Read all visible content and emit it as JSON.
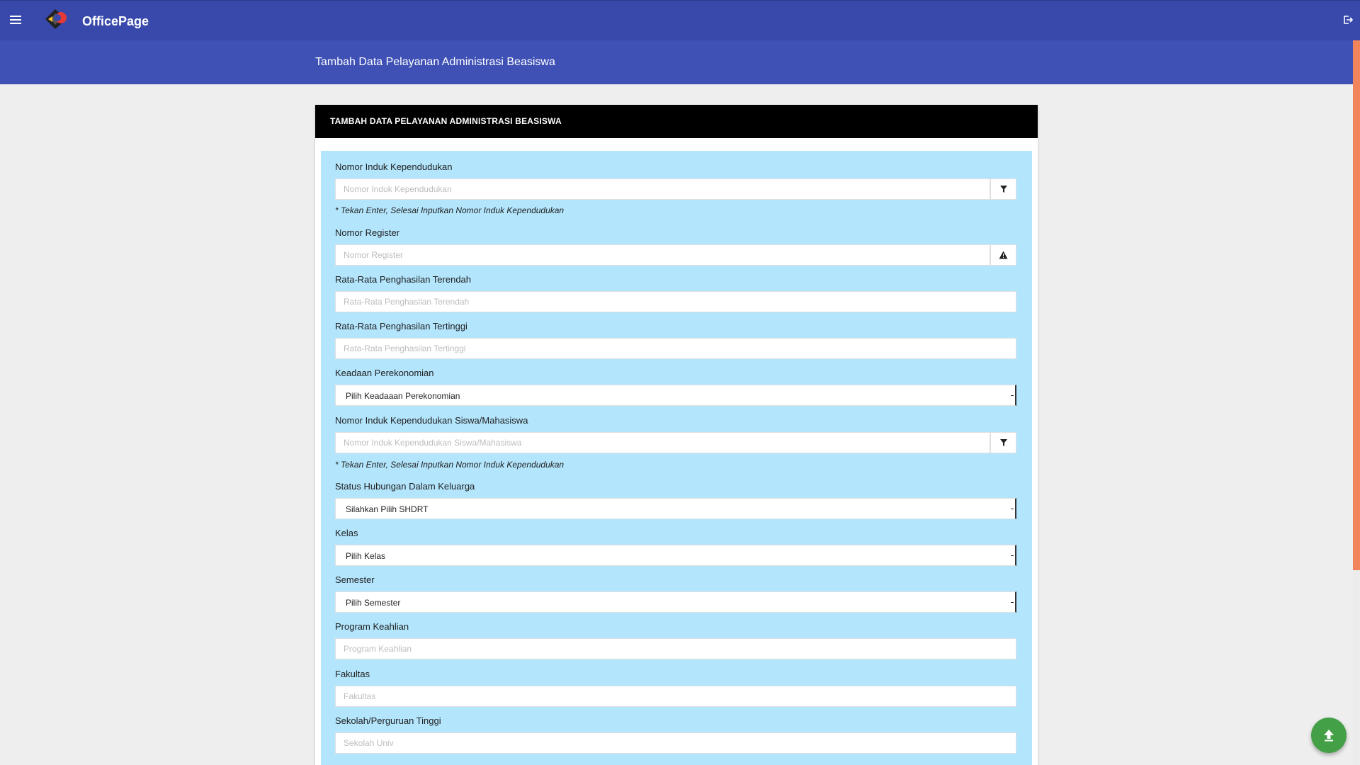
{
  "app": {
    "brand": "OfficePage"
  },
  "header": {
    "page_title": "Tambah Data Pelayanan Administrasi Beasiswa"
  },
  "card": {
    "title": "TAMBAH DATA PELAYANAN ADMINISTRASI BEASISWA"
  },
  "icons": {
    "menu": "hamburger-menu-icon",
    "logout": "logout-icon",
    "filter": "filter-icon",
    "warning": "warning-icon",
    "scroll_top": "arrow-up-icon"
  },
  "colors": {
    "topbar": "#3949ab",
    "subheader": "#3f51b5",
    "form_background": "#b3e5fc",
    "card_header": "#000000",
    "fab": "#43a047",
    "scrollbar": "#f2845c"
  },
  "form": {
    "nik": {
      "label": "Nomor Induk Kependudukan",
      "placeholder": "Nomor Induk Kependudukan",
      "value": ""
    },
    "nik_hint": "* Tekan Enter, Selesai Inputkan Nomor Induk Kependudukan",
    "nomor_register": {
      "label": "Nomor Register",
      "placeholder": "Nomor Register",
      "value": ""
    },
    "penghasilan_terendah": {
      "label": "Rata-Rata Penghasilan Terendah",
      "placeholder": "Rata-Rata Penghasilan Terendah",
      "value": ""
    },
    "penghasilan_tertinggi": {
      "label": "Rata-Rata Penghasilan Tertinggi",
      "placeholder": "Rata-Rata Penghasilan Tertinggi",
      "value": ""
    },
    "keadaan_perekonomian": {
      "label": "Keadaan Perekonomian",
      "selected": "Pilih Keadaaan Perekonomian"
    },
    "nik_siswa": {
      "label": "Nomor Induk Kependudukan Siswa/Mahasiswa",
      "placeholder": "Nomor Induk Kependudukan Siswa/Mahasiswa",
      "value": ""
    },
    "nik_siswa_hint": "* Tekan Enter, Selesai Inputkan Nomor Induk Kependudukan",
    "status_hubungan": {
      "label": "Status Hubungan Dalam Keluarga",
      "selected": "Silahkan Pilih SHDRT"
    },
    "kelas": {
      "label": "Kelas",
      "selected": "Pilih Kelas"
    },
    "semester": {
      "label": "Semester",
      "selected": "Pilih Semester"
    },
    "program_keahlian": {
      "label": "Program Keahlian",
      "placeholder": "Program Keahlian",
      "value": ""
    },
    "fakultas": {
      "label": "Fakultas",
      "placeholder": "Fakultas",
      "value": ""
    },
    "sekolah": {
      "label": "Sekolah/Perguruan Tinggi",
      "placeholder": "Sekolah Univ",
      "value": ""
    }
  }
}
